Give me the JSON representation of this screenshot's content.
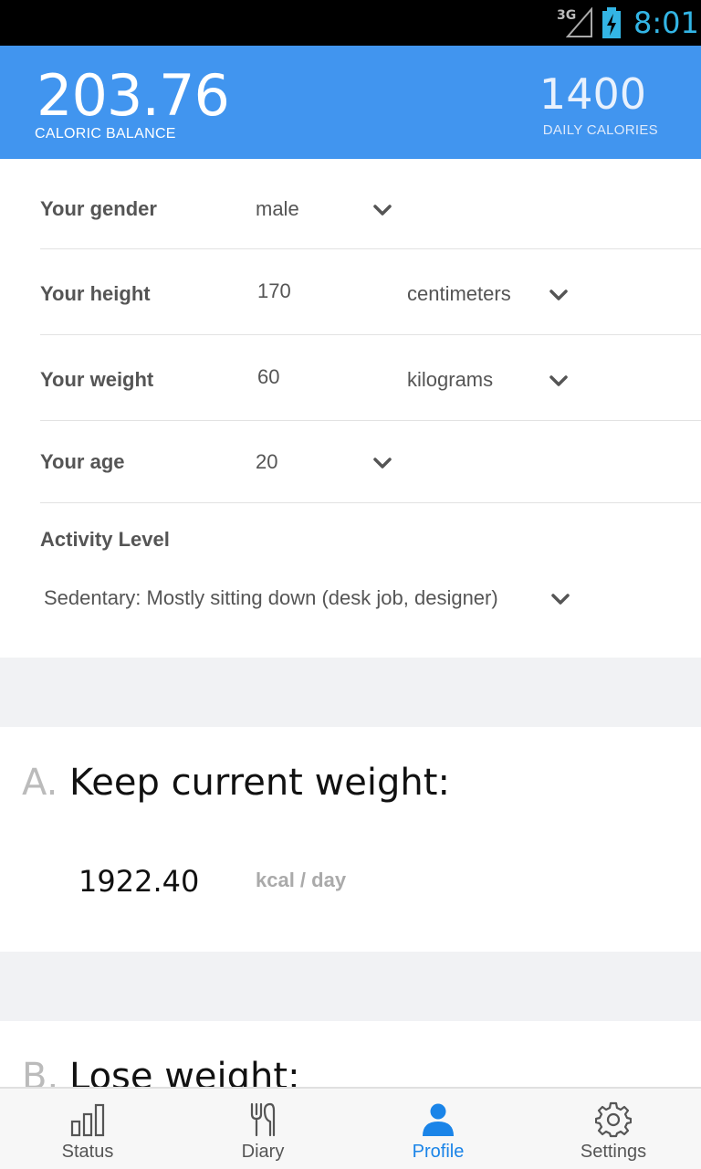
{
  "status_bar": {
    "network": "3G",
    "clock": "8:01",
    "icons": [
      "signal-icon",
      "battery-charging-icon"
    ]
  },
  "header": {
    "caloric_balance": "203.76",
    "caloric_balance_label": "CALORIC BALANCE",
    "daily_calories": "1400",
    "daily_calories_label": "DAILY CALORIES"
  },
  "profile": {
    "gender": {
      "label": "Your gender",
      "value": "male"
    },
    "height": {
      "label": "Your height",
      "value": "170",
      "unit": "centimeters"
    },
    "weight": {
      "label": "Your weight",
      "value": "60",
      "unit": "kilograms"
    },
    "age": {
      "label": "Your age",
      "value": "20"
    },
    "activity": {
      "label": "Activity Level",
      "value": "Sedentary: Mostly sitting down (desk job, designer)"
    }
  },
  "goals": [
    {
      "letter": "A.",
      "title": "Keep current weight:",
      "kcal": "1922.40",
      "unit": "kcal / day"
    },
    {
      "letter": "B.",
      "title": "Lose weight:"
    }
  ],
  "bottom_nav": {
    "items": [
      {
        "label": "Status",
        "icon": "bar-chart-icon"
      },
      {
        "label": "Diary",
        "icon": "fork-knife-icon"
      },
      {
        "label": "Profile",
        "icon": "person-icon",
        "active": true
      },
      {
        "label": "Settings",
        "icon": "gear-icon"
      }
    ]
  },
  "colors": {
    "header_bg": "#4195ef",
    "accent": "#1a84e8",
    "clock": "#33b5e5",
    "background": "#f1f2f4"
  }
}
